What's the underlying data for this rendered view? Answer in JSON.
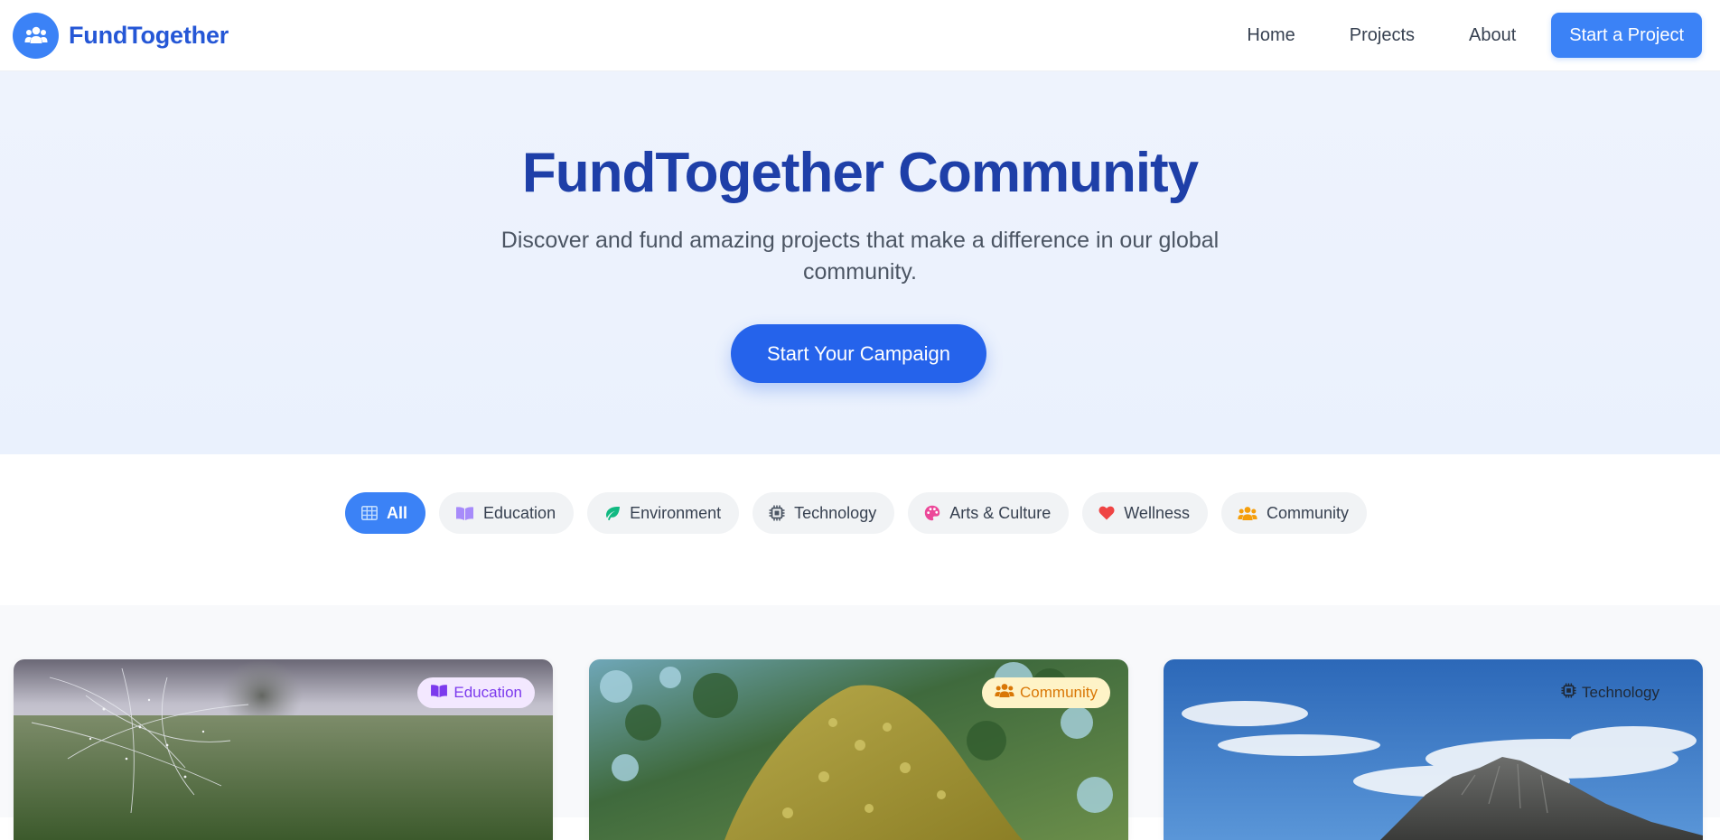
{
  "brand": {
    "name": "FundTogether",
    "icon": "users-icon",
    "color": "#3b82f6"
  },
  "nav": {
    "links": [
      "Home",
      "Projects",
      "About"
    ],
    "cta": "Start a Project"
  },
  "hero": {
    "title": "FundTogether Community",
    "subtitle": "Discover and fund amazing projects that make a difference in our global community.",
    "cta": "Start Your Campaign"
  },
  "filters": {
    "active": "All",
    "chips": [
      {
        "label": "All",
        "icon": "grid-icon",
        "color": "#ffffff"
      },
      {
        "label": "Education",
        "icon": "book-icon",
        "color": "#a78bfa"
      },
      {
        "label": "Environment",
        "icon": "leaf-icon",
        "color": "#10b981"
      },
      {
        "label": "Technology",
        "icon": "chip-icon",
        "color": "#4b5563"
      },
      {
        "label": "Arts & Culture",
        "icon": "palette-icon",
        "color": "#ec4899"
      },
      {
        "label": "Wellness",
        "icon": "heart-icon",
        "color": "#ef4444"
      },
      {
        "label": "Community",
        "icon": "users-icon",
        "color": "#f59e0b"
      }
    ]
  },
  "cards": [
    {
      "category": "Education",
      "icon": "book-icon",
      "image": "misty field with spider web"
    },
    {
      "category": "Community",
      "icon": "users-icon",
      "image": "mossy tree trunk against sky"
    },
    {
      "category": "Technology",
      "icon": "chip-icon",
      "image": "rocky mountain under blue sky"
    }
  ]
}
